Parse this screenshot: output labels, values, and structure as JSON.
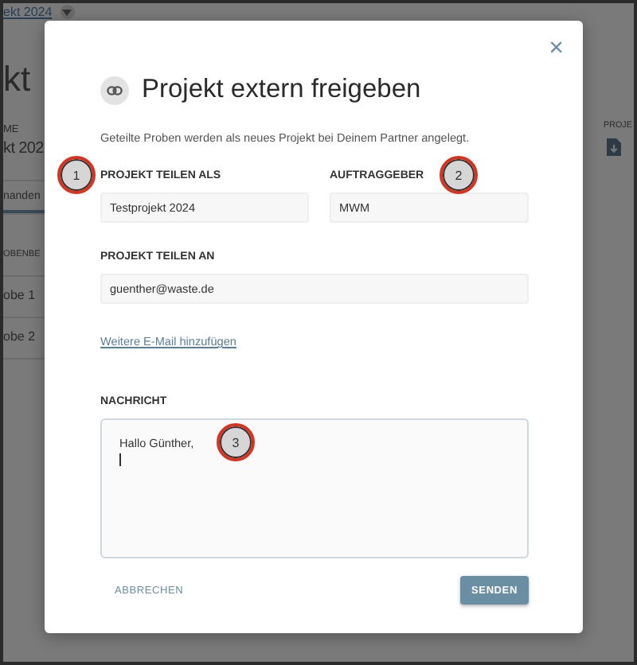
{
  "background": {
    "breadcrumb": "ekt 2024",
    "title": "kt",
    "field_label": "ME",
    "field_value": "kt 202",
    "right_label": "PROJE",
    "tab": {
      "label": "nanden",
      "selected": true
    },
    "table": {
      "column": "OBENBE",
      "rows": [
        "obe 1",
        "obe 2"
      ]
    }
  },
  "dialog": {
    "close": "×",
    "title": "Projekt extern freigeben",
    "description": "Geteilte Proben werden als neues Projekt bei Deinem Partner angelegt.",
    "fields": [
      {
        "label": "PROJEKT TEILEN ALS",
        "value": "Testprojekt 2024"
      },
      {
        "label": "AUFTRAGGEBER",
        "value": "MWM"
      }
    ],
    "share_to": {
      "label": "PROJEKT TEILEN AN",
      "value": "guenther@waste.de"
    },
    "add_email_link": "Weitere E-Mail hinzufügen",
    "message": {
      "label": "NACHRICHT",
      "value": "Hallo Günther,"
    },
    "buttons": [
      {
        "label": "ABBRECHEN",
        "kind": "text"
      },
      {
        "label": "SENDEN",
        "kind": "primary"
      }
    ]
  },
  "annotations": [
    {
      "label": "1"
    },
    {
      "label": "2"
    },
    {
      "label": "3"
    }
  ]
}
